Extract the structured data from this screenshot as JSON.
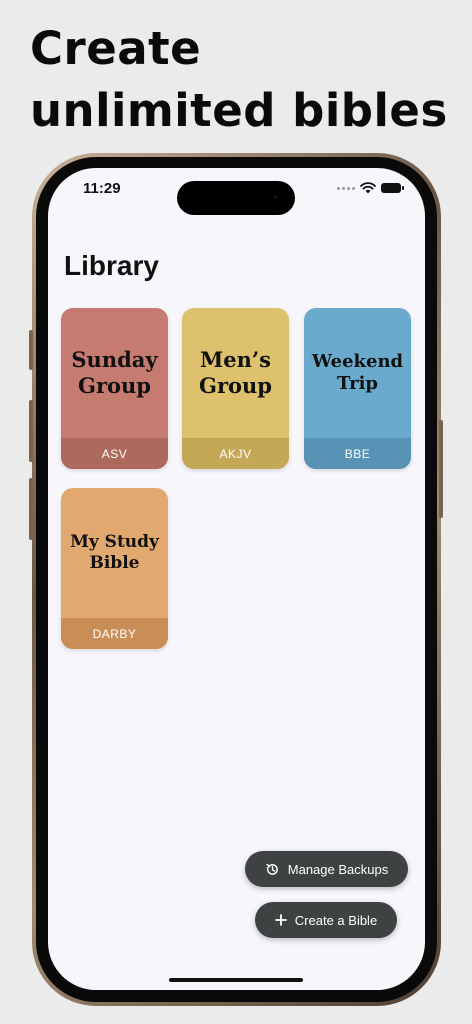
{
  "headline": "Create unlimited bibles",
  "status_bar": {
    "time": "11:29"
  },
  "library": {
    "title": "Library",
    "bibles": [
      {
        "title": "Sunday Group",
        "version": "ASV",
        "color": "#c57b6f",
        "footer_color": "#ad6a5c"
      },
      {
        "title": "Men’s Group",
        "version": "AKJV",
        "color": "#ddc16c",
        "footer_color": "#c5a856"
      },
      {
        "title": "Weekend Trip",
        "version": "BBE",
        "color": "#6aaacc",
        "footer_color": "#5893b5"
      },
      {
        "title": "My Study Bible",
        "version": "DARBY",
        "color": "#e1a96f",
        "footer_color": "#c98e56"
      }
    ]
  },
  "actions": {
    "manage_backups": "Manage Backups",
    "create_bible": "Create a Bible"
  },
  "icons": {
    "manage_backups": "history-icon",
    "create_bible": "plus-icon"
  }
}
